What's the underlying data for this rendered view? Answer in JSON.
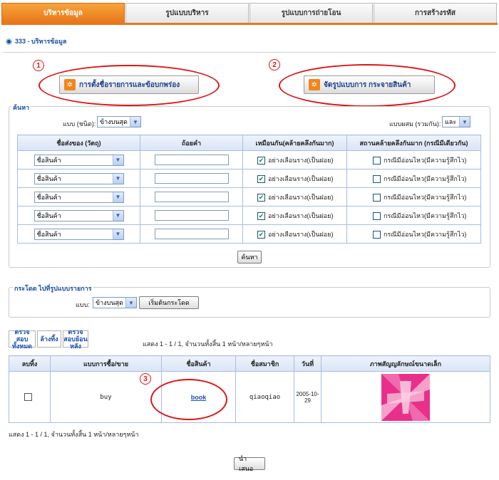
{
  "tabs": [
    {
      "label": "บริหารข้อมูล",
      "active": true
    },
    {
      "label": "รูปแบบบริหาร",
      "active": false
    },
    {
      "label": "รูปแบบการถ่ายโอน",
      "active": false
    },
    {
      "label": "การสร้างรหัส",
      "active": false
    }
  ],
  "breadcrumb": "333 - บริหารข้อมูล",
  "buttons": {
    "list_settings": "การตั้งชื่อรายการและข้อบกพร่อง",
    "distribution": "จัดรูปแบบการ กระจายสินค้า"
  },
  "markers": [
    "1",
    "2",
    "3"
  ],
  "search": {
    "legend": "ค้นหา",
    "mode_label": "แบบ (ชนิด):",
    "mode_value": "ข้างบนสุด",
    "combine_label": "แบบผสม (รวมกัน):",
    "combine_value": "และ",
    "columns": [
      "ชื่อส่งของ (วัตถุ)",
      "ถ้อยคำ",
      "เหมือนกัน(คล้ายคลึงกันมาก)",
      "สถานคล้ายคลึงกันมาก (กรณีมีเดียวกัน)"
    ],
    "rows": [
      {
        "field": "ชื่อสินค้า",
        "keyword": "",
        "similar_label": "อย่างเลือนราง(เป็นฝอย)",
        "similar_checked": true,
        "exact_label": "กรณีมีอ่อนไหว(มีความรู้สึกไว)",
        "exact_checked": false
      },
      {
        "field": "ชื่อสินค้า",
        "keyword": "",
        "similar_label": "อย่างเลือนราง(เป็นฝอย)",
        "similar_checked": true,
        "exact_label": "กรณีมีอ่อนไหว(มีความรู้สึกไว)",
        "exact_checked": false
      },
      {
        "field": "ชื่อสินค้า",
        "keyword": "",
        "similar_label": "อย่างเลือนราง(เป็นฝอย)",
        "similar_checked": true,
        "exact_label": "กรณีมีอ่อนไหว(มีความรู้สึกไว)",
        "exact_checked": false
      },
      {
        "field": "ชื่อสินค้า",
        "keyword": "",
        "similar_label": "อย่างเลือนราง(เป็นฝอย)",
        "similar_checked": true,
        "exact_label": "กรณีมีอ่อนไหว(มีความรู้สึกไว)",
        "exact_checked": false
      },
      {
        "field": "ชื่อสินค้า",
        "keyword": "",
        "similar_label": "อย่างเลือนราง(เป็นฝอย)",
        "similar_checked": true,
        "exact_label": "กรณีมีอ่อนไหว(มีความรู้สึกไว)",
        "exact_checked": false
      }
    ],
    "submit_label": "ค้นหา"
  },
  "jump": {
    "legend": "กระโดด ไปที่รูปแบบรายการ",
    "mode_label": "แบบ:",
    "mode_value": "ข้างบนสุด",
    "start_label": "เริ่มต้นกระโดด"
  },
  "list_actions": {
    "check_all": "ตรวจสอบทั้งหมด",
    "clear": "ล้างทิ้ง",
    "check_reverse": "ตรวจสอบย้อนหลัง"
  },
  "paging_top": "แสดง 1 - 1 / 1,  จำนวนทั้งสิ้น 1 หน้า/หลายๆหน้า",
  "paging_bottom": "แสดง 1 - 1 / 1,  จำนวนทั้งสิ้น 1 หน้า/หลายๆหน้า",
  "results": {
    "columns": [
      "ลบทิ้ง",
      "แบบการซื้อ/ขาย",
      "ชื่อสินค้า",
      "ชื่อสมาชิก",
      "วันที่",
      "ภาพสัญญลักษณ์ขนาดเล็ก"
    ],
    "rows": [
      {
        "type": "buy",
        "product": "book",
        "member": "qiaoqiao",
        "date": "2005-10-29"
      }
    ]
  },
  "submit": "นำเสนอ",
  "colors": {
    "accent": "#e8771a",
    "link": "#1a4f9c",
    "annotation": "#e01414",
    "thumb": "#e8308a"
  }
}
